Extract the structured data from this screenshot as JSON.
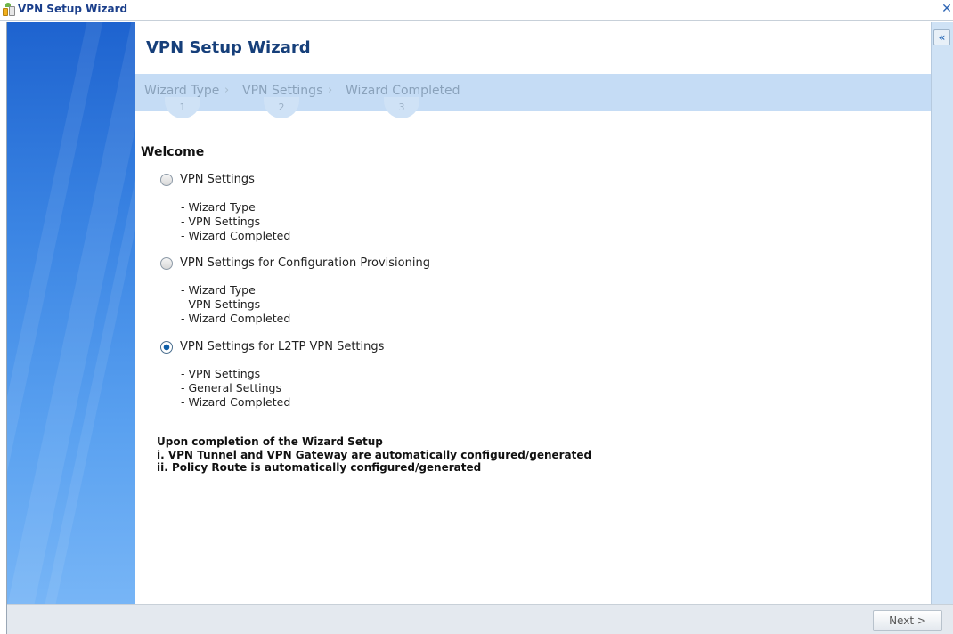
{
  "window": {
    "title": "VPN Setup Wizard",
    "close_icon": "✕",
    "collapse_icon": "«"
  },
  "wizard": {
    "heading": "VPN Setup Wizard",
    "steps": [
      {
        "label": "Wizard Type",
        "number": "1"
      },
      {
        "label": "VPN Settings",
        "number": "2"
      },
      {
        "label": "Wizard Completed",
        "number": "3"
      }
    ],
    "separator": "›"
  },
  "welcome": "Welcome",
  "options": [
    {
      "label": "VPN Settings",
      "checked": false,
      "items": [
        "- Wizard Type",
        "- VPN Settings",
        "- Wizard Completed"
      ]
    },
    {
      "label": "VPN Settings for Configuration Provisioning",
      "checked": false,
      "items": [
        "- Wizard Type",
        "- VPN Settings",
        "- Wizard Completed"
      ]
    },
    {
      "label": "VPN Settings for L2TP VPN Settings",
      "checked": true,
      "items": [
        "- VPN Settings",
        "- General Settings",
        "- Wizard Completed"
      ]
    }
  ],
  "note": {
    "line1": "Upon completion of the Wizard Setup",
    "line2": "i. VPN Tunnel and VPN Gateway are automatically configured/generated",
    "line3": "ii. Policy Route is automatically configured/generated"
  },
  "footer": {
    "next_label": "Next >"
  },
  "colors": {
    "accent": "#163f7a",
    "step_bar": "#c5dcf5",
    "sidebar_top": "#1e63cf",
    "sidebar_bottom": "#77b5f6"
  }
}
